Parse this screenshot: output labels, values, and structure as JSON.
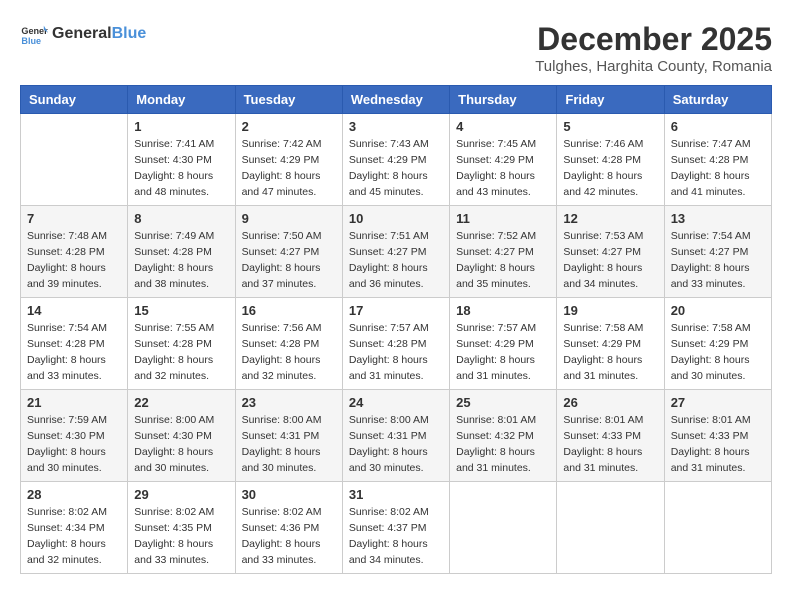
{
  "logo": {
    "text_general": "General",
    "text_blue": "Blue"
  },
  "header": {
    "title": "December 2025",
    "subtitle": "Tulghes, Harghita County, Romania"
  },
  "weekdays": [
    "Sunday",
    "Monday",
    "Tuesday",
    "Wednesday",
    "Thursday",
    "Friday",
    "Saturday"
  ],
  "weeks": [
    [
      {
        "day": "",
        "info": ""
      },
      {
        "day": "1",
        "info": "Sunrise: 7:41 AM\nSunset: 4:30 PM\nDaylight: 8 hours\nand 48 minutes."
      },
      {
        "day": "2",
        "info": "Sunrise: 7:42 AM\nSunset: 4:29 PM\nDaylight: 8 hours\nand 47 minutes."
      },
      {
        "day": "3",
        "info": "Sunrise: 7:43 AM\nSunset: 4:29 PM\nDaylight: 8 hours\nand 45 minutes."
      },
      {
        "day": "4",
        "info": "Sunrise: 7:45 AM\nSunset: 4:29 PM\nDaylight: 8 hours\nand 43 minutes."
      },
      {
        "day": "5",
        "info": "Sunrise: 7:46 AM\nSunset: 4:28 PM\nDaylight: 8 hours\nand 42 minutes."
      },
      {
        "day": "6",
        "info": "Sunrise: 7:47 AM\nSunset: 4:28 PM\nDaylight: 8 hours\nand 41 minutes."
      }
    ],
    [
      {
        "day": "7",
        "info": "Sunrise: 7:48 AM\nSunset: 4:28 PM\nDaylight: 8 hours\nand 39 minutes."
      },
      {
        "day": "8",
        "info": "Sunrise: 7:49 AM\nSunset: 4:28 PM\nDaylight: 8 hours\nand 38 minutes."
      },
      {
        "day": "9",
        "info": "Sunrise: 7:50 AM\nSunset: 4:27 PM\nDaylight: 8 hours\nand 37 minutes."
      },
      {
        "day": "10",
        "info": "Sunrise: 7:51 AM\nSunset: 4:27 PM\nDaylight: 8 hours\nand 36 minutes."
      },
      {
        "day": "11",
        "info": "Sunrise: 7:52 AM\nSunset: 4:27 PM\nDaylight: 8 hours\nand 35 minutes."
      },
      {
        "day": "12",
        "info": "Sunrise: 7:53 AM\nSunset: 4:27 PM\nDaylight: 8 hours\nand 34 minutes."
      },
      {
        "day": "13",
        "info": "Sunrise: 7:54 AM\nSunset: 4:27 PM\nDaylight: 8 hours\nand 33 minutes."
      }
    ],
    [
      {
        "day": "14",
        "info": "Sunrise: 7:54 AM\nSunset: 4:28 PM\nDaylight: 8 hours\nand 33 minutes."
      },
      {
        "day": "15",
        "info": "Sunrise: 7:55 AM\nSunset: 4:28 PM\nDaylight: 8 hours\nand 32 minutes."
      },
      {
        "day": "16",
        "info": "Sunrise: 7:56 AM\nSunset: 4:28 PM\nDaylight: 8 hours\nand 32 minutes."
      },
      {
        "day": "17",
        "info": "Sunrise: 7:57 AM\nSunset: 4:28 PM\nDaylight: 8 hours\nand 31 minutes."
      },
      {
        "day": "18",
        "info": "Sunrise: 7:57 AM\nSunset: 4:29 PM\nDaylight: 8 hours\nand 31 minutes."
      },
      {
        "day": "19",
        "info": "Sunrise: 7:58 AM\nSunset: 4:29 PM\nDaylight: 8 hours\nand 31 minutes."
      },
      {
        "day": "20",
        "info": "Sunrise: 7:58 AM\nSunset: 4:29 PM\nDaylight: 8 hours\nand 30 minutes."
      }
    ],
    [
      {
        "day": "21",
        "info": "Sunrise: 7:59 AM\nSunset: 4:30 PM\nDaylight: 8 hours\nand 30 minutes."
      },
      {
        "day": "22",
        "info": "Sunrise: 8:00 AM\nSunset: 4:30 PM\nDaylight: 8 hours\nand 30 minutes."
      },
      {
        "day": "23",
        "info": "Sunrise: 8:00 AM\nSunset: 4:31 PM\nDaylight: 8 hours\nand 30 minutes."
      },
      {
        "day": "24",
        "info": "Sunrise: 8:00 AM\nSunset: 4:31 PM\nDaylight: 8 hours\nand 30 minutes."
      },
      {
        "day": "25",
        "info": "Sunrise: 8:01 AM\nSunset: 4:32 PM\nDaylight: 8 hours\nand 31 minutes."
      },
      {
        "day": "26",
        "info": "Sunrise: 8:01 AM\nSunset: 4:33 PM\nDaylight: 8 hours\nand 31 minutes."
      },
      {
        "day": "27",
        "info": "Sunrise: 8:01 AM\nSunset: 4:33 PM\nDaylight: 8 hours\nand 31 minutes."
      }
    ],
    [
      {
        "day": "28",
        "info": "Sunrise: 8:02 AM\nSunset: 4:34 PM\nDaylight: 8 hours\nand 32 minutes."
      },
      {
        "day": "29",
        "info": "Sunrise: 8:02 AM\nSunset: 4:35 PM\nDaylight: 8 hours\nand 33 minutes."
      },
      {
        "day": "30",
        "info": "Sunrise: 8:02 AM\nSunset: 4:36 PM\nDaylight: 8 hours\nand 33 minutes."
      },
      {
        "day": "31",
        "info": "Sunrise: 8:02 AM\nSunset: 4:37 PM\nDaylight: 8 hours\nand 34 minutes."
      },
      {
        "day": "",
        "info": ""
      },
      {
        "day": "",
        "info": ""
      },
      {
        "day": "",
        "info": ""
      }
    ]
  ]
}
